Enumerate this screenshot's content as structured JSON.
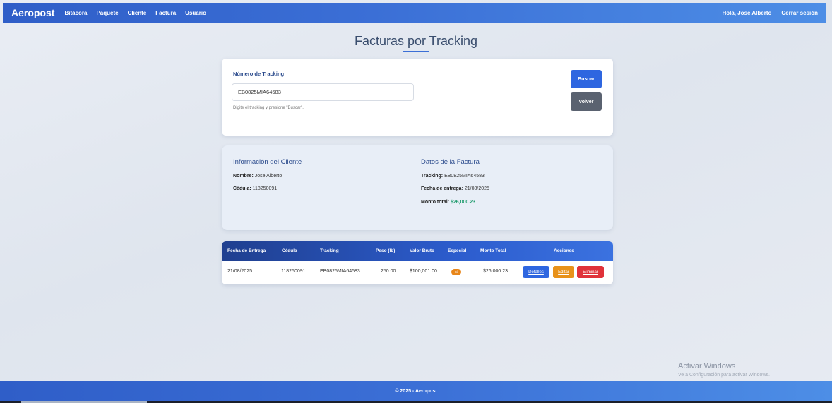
{
  "navbar": {
    "brand": "Aeropost",
    "links": [
      "Bitácora",
      "Paquete",
      "Cliente",
      "Factura",
      "Usuario"
    ],
    "greeting": "Hola, Jose Alberto",
    "logout": "Cerrar sesión"
  },
  "page": {
    "title": "Facturas por Tracking"
  },
  "search": {
    "label": "Número de Tracking",
    "value": "EB0825MIA64583",
    "help": "Digite el tracking y presione \"Buscar\".",
    "buscar": "Buscar",
    "volver": "Volver"
  },
  "cliente": {
    "heading": "Información del Cliente",
    "nombre_label": "Nombre:",
    "nombre": "Jose Alberto",
    "cedula_label": "Cédula:",
    "cedula": "118250091"
  },
  "factura": {
    "heading": "Datos de la Factura",
    "tracking_label": "Tracking:",
    "tracking": "EB0825MIA64583",
    "fecha_label": "Fecha de entrega:",
    "fecha": "21/08/2025",
    "monto_label": "Monto total:",
    "monto": "$26,000.23"
  },
  "table": {
    "headers": [
      "Fecha de Entrega",
      "Cédula",
      "Tracking",
      "Peso (lb)",
      "Valor Bruto",
      "Especial",
      "Monto Total",
      "Acciones"
    ],
    "rows": [
      {
        "fecha": "21/08/2025",
        "cedula": "118250091",
        "tracking": "EB0825MIA64583",
        "peso": "250.00",
        "valor_bruto": "$100,001.00",
        "especial": "Sí",
        "monto_total": "$26,000.23",
        "detalles": "Detalles",
        "editar": "Editar",
        "eliminar": "Eliminar"
      }
    ]
  },
  "watermark": {
    "line1": "Activar Windows",
    "line2": "Ve a Configuración para activar Windows."
  },
  "footer": {
    "text": "© 2025 - Aeropost"
  },
  "colors": {
    "primary": "#2e66e0",
    "success": "#1c9a6b",
    "warning": "#e8921a",
    "danger": "#e0323a"
  }
}
